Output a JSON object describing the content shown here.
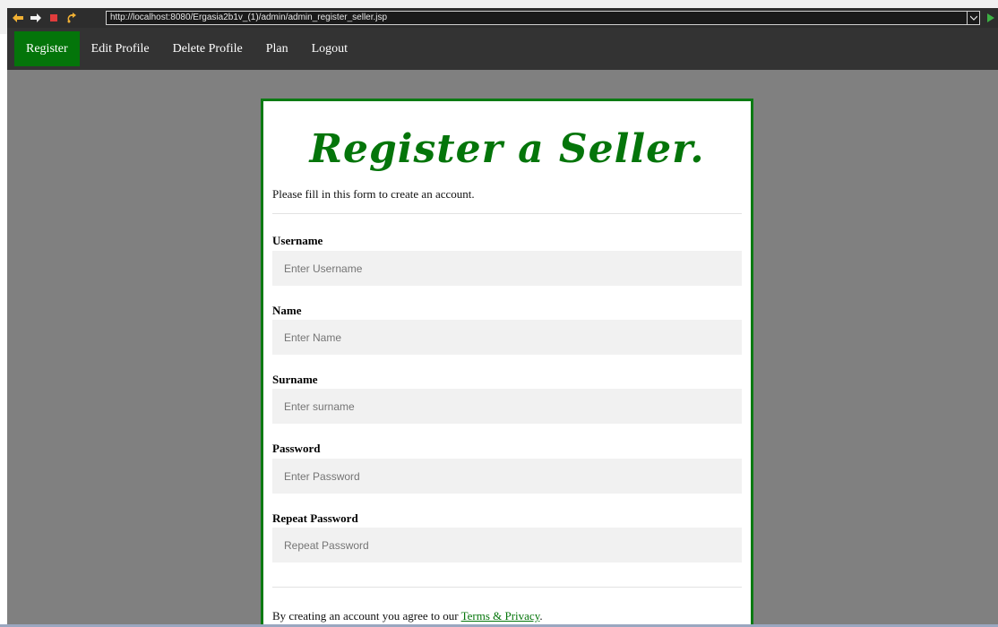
{
  "browser": {
    "url": "http://localhost:8080/Ergasia2b1v_(1)/admin/admin_register_seller.jsp",
    "icons": [
      "back-arrow-icon",
      "forward-arrow-icon",
      "stop-icon",
      "refresh-icon",
      "chevron-down-icon",
      "go-icon"
    ]
  },
  "nav": {
    "items": [
      {
        "label": "Register",
        "active": true
      },
      {
        "label": "Edit Profile",
        "active": false
      },
      {
        "label": "Delete Profile",
        "active": false
      },
      {
        "label": "Plan",
        "active": false
      },
      {
        "label": "Logout",
        "active": false
      }
    ]
  },
  "form": {
    "title": "Register a Seller.",
    "subtitle": "Please fill in this form to create an account.",
    "fields": [
      {
        "label": "Username",
        "placeholder": "Enter Username",
        "value": ""
      },
      {
        "label": "Name",
        "placeholder": "Enter Name",
        "value": ""
      },
      {
        "label": "Surname",
        "placeholder": "Enter surname",
        "value": ""
      },
      {
        "label": "Password",
        "placeholder": "Enter Password",
        "value": ""
      },
      {
        "label": "Repeat Password",
        "placeholder": "Repeat Password",
        "value": ""
      }
    ],
    "terms_prefix": "By creating an account you agree to our ",
    "terms_link": "Terms & Privacy",
    "terms_suffix": "."
  },
  "colors": {
    "accent": "#04750a",
    "nav_bg": "#333333",
    "page_bg": "#808080",
    "input_bg": "#f1f1f1"
  }
}
